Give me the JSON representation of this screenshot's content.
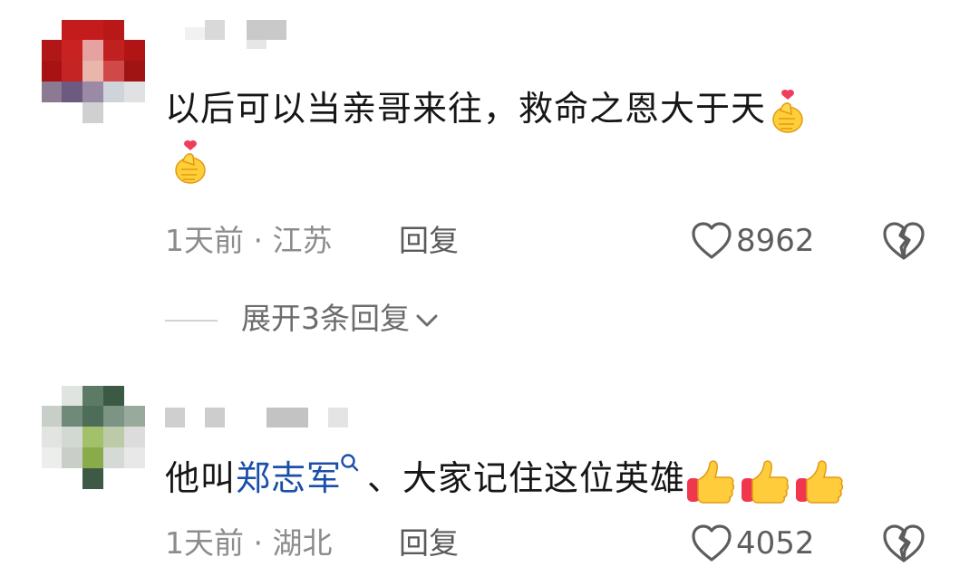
{
  "comments": [
    {
      "text": "以后可以当亲哥来往，救命之恩大于天",
      "emoji_icons": [
        "finger-heart-icon",
        "finger-heart-icon"
      ],
      "time": "1天前",
      "separator": "·",
      "location": "江苏",
      "reply_label": "回复",
      "like_count": "8962",
      "expand_label": "展开3条回复",
      "avatar_colors": [
        "#b01818",
        "#c93232",
        "#e8a0a0",
        "#7a6a8a"
      ]
    },
    {
      "text_before": "他叫",
      "mention": "郑志军",
      "text_after": "、大家记住这位英雄",
      "emoji_icons": [
        "thumbs-up-icon",
        "thumbs-up-icon",
        "thumbs-up-icon"
      ],
      "time": "1天前",
      "separator": "·",
      "location": "湖北",
      "reply_label": "回复",
      "like_count": "4052",
      "avatar_colors": [
        "#3c5a48",
        "#8fb060",
        "#c8d0c8",
        "#2f4a3a"
      ]
    }
  ],
  "colors": {
    "mention": "#1a4fa8",
    "meta_text": "#8c8c8c",
    "body_text": "#161616"
  }
}
